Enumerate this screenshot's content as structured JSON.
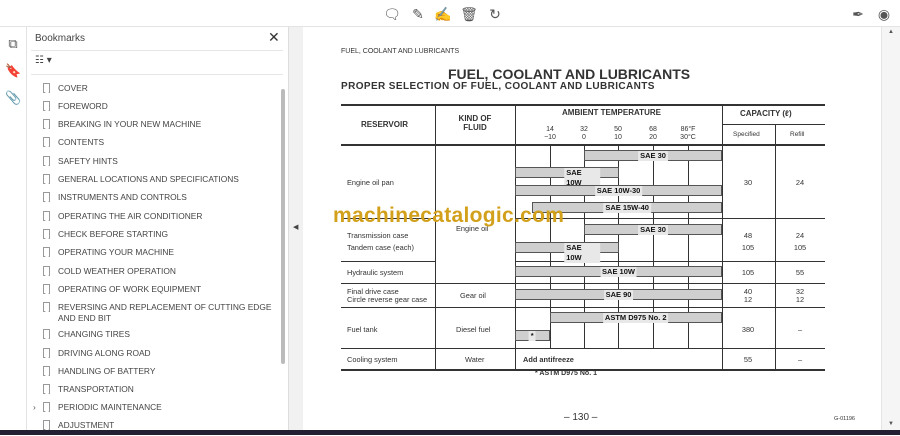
{
  "toolbar": {
    "icons": [
      "comment-icon",
      "pen-icon",
      "sign-icon",
      "trash-icon",
      "rotate-icon"
    ],
    "right_icons": [
      "edit-sign-icon",
      "account-icon"
    ]
  },
  "bookmarks": {
    "title": "Bookmarks",
    "items": [
      "COVER",
      "FOREWORD",
      "BREAKING IN YOUR NEW MACHINE",
      "CONTENTS",
      "SAFETY HINTS",
      "GENERAL LOCATIONS AND SPECIFICATIONS",
      "INSTRUMENTS AND CONTROLS",
      "OPERATING THE AIR CONDITIONER",
      "CHECK BEFORE STARTING",
      "OPERATING YOUR MACHINE",
      "COLD WEATHER OPERATION",
      "OPERATING OF WORK EQUIPMENT",
      "REVERSING AND REPLACEMENT OF CUTTING EDGE AND END BIT",
      "CHANGING TIRES",
      "DRIVING ALONG ROAD",
      "HANDLING OF BATTERY",
      "TRANSPORTATION",
      "PERIODIC MAINTENANCE",
      "ADJUSTMENT"
    ]
  },
  "page": {
    "running_head": "FUEL, COOLANT AND LUBRICANTS",
    "title": "FUEL, COOLANT AND LUBRICANTS",
    "subtitle": "PROPER SELECTION OF FUEL, COOLANT AND LUBRICANTS",
    "headers": {
      "reservoir": "RESERVOIR",
      "fluid": "KIND OF FLUID",
      "ambient": "AMBIENT TEMPERATURE",
      "capacity": "CAPACITY (ℓ)",
      "specified": "Specified",
      "refill": "Refill"
    },
    "ticks": [
      {
        "f": "14",
        "c": "−10"
      },
      {
        "f": "32",
        "c": "0"
      },
      {
        "f": "50",
        "c": "10"
      },
      {
        "f": "68",
        "c": "20"
      },
      {
        "f": "86°F",
        "c": "30°C"
      }
    ],
    "rows": [
      {
        "reservoir": "Engine oil pan",
        "specified": "30",
        "refill": "24"
      },
      {
        "reservoir": "Transmission case",
        "specified": "48",
        "refill": "24"
      },
      {
        "reservoir": "Tandem case (each)",
        "specified": "105",
        "refill": "105"
      },
      {
        "reservoir": "Hydraulic system",
        "specified": "105",
        "refill": "55"
      },
      {
        "reservoir": "Final drive case",
        "specified": "40",
        "refill": "32"
      },
      {
        "reservoir": "Circle reverse gear case",
        "specified": "12",
        "refill": "12"
      },
      {
        "reservoir": "Fuel tank",
        "specified": "380",
        "refill": "–"
      },
      {
        "reservoir": "Cooling system",
        "specified": "55",
        "refill": "–"
      }
    ],
    "fluids": {
      "engine": "Engine oil",
      "gear": "Gear oil",
      "diesel": "Diesel fuel",
      "water": "Water"
    },
    "bars": [
      {
        "label": "SAE 30",
        "from_f": 32,
        "to_f": 104
      },
      {
        "label": "SAE 10W",
        "from_f": -4,
        "to_f": 50
      },
      {
        "label": "SAE 10W-30",
        "from_f": -4,
        "to_f": 104
      },
      {
        "label": "SAE 15W-40",
        "from_f": 5,
        "to_f": 104
      },
      {
        "label": "SAE 30",
        "from_f": 32,
        "to_f": 104
      },
      {
        "label": "SAE 10W",
        "from_f": -4,
        "to_f": 50
      },
      {
        "label": "SAE 10W",
        "from_f": -4,
        "to_f": 104
      },
      {
        "label": "SAE 90",
        "from_f": -4,
        "to_f": 104
      },
      {
        "label": "ASTM D975 No. 2",
        "from_f": 14,
        "to_f": 104
      },
      {
        "label": "*",
        "from_f": -4,
        "to_f": 14
      }
    ],
    "antifreeze": "Add antifreeze",
    "footnote": "* ASTM D975 No. 1",
    "page_number": "– 130 –",
    "code": "G-01196",
    "watermark": "machinecatalogic.com"
  }
}
